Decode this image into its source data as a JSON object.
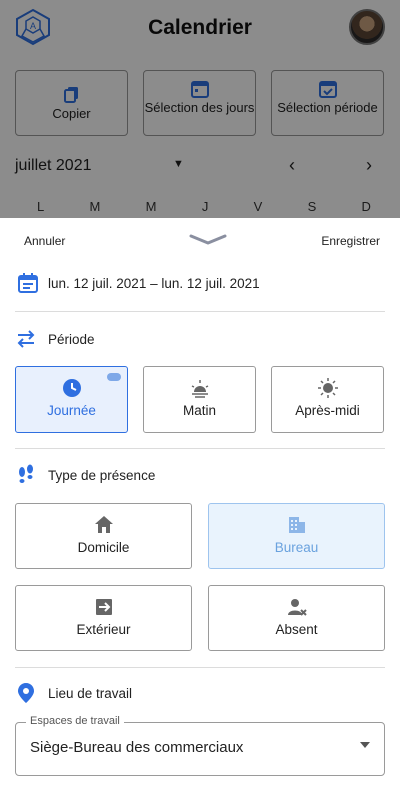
{
  "header": {
    "title": "Calendrier"
  },
  "actions": [
    {
      "label": "Copier"
    },
    {
      "label": "Sélection des jours"
    },
    {
      "label": "Sélection période"
    }
  ],
  "calendar": {
    "month": "juillet 2021",
    "weekdays": [
      "L",
      "M",
      "M",
      "J",
      "V",
      "S",
      "D"
    ]
  },
  "sheet": {
    "cancel_label": "Annuler",
    "save_label": "Enregistrer",
    "date_range": "lun. 12 juil. 2021 – lun. 12 juil. 2021",
    "period": {
      "title": "Période",
      "options": [
        {
          "label": "Journée",
          "selected": true
        },
        {
          "label": "Matin",
          "selected": false
        },
        {
          "label": "Après-midi",
          "selected": false
        }
      ]
    },
    "presence": {
      "title": "Type de présence",
      "options": [
        {
          "label": "Domicile",
          "selected": false
        },
        {
          "label": "Bureau",
          "selected": true
        },
        {
          "label": "Extérieur",
          "selected": false
        },
        {
          "label": "Absent",
          "selected": false
        }
      ]
    },
    "workplace": {
      "title": "Lieu de travail",
      "field_label": "Espaces de travail",
      "value": "Siège-Bureau des commerciaux"
    }
  },
  "colors": {
    "accent": "#2f6fe0",
    "selected_bg": "#e8f0fd",
    "dim_overlay": "rgba(0,0,0,0.45)"
  }
}
